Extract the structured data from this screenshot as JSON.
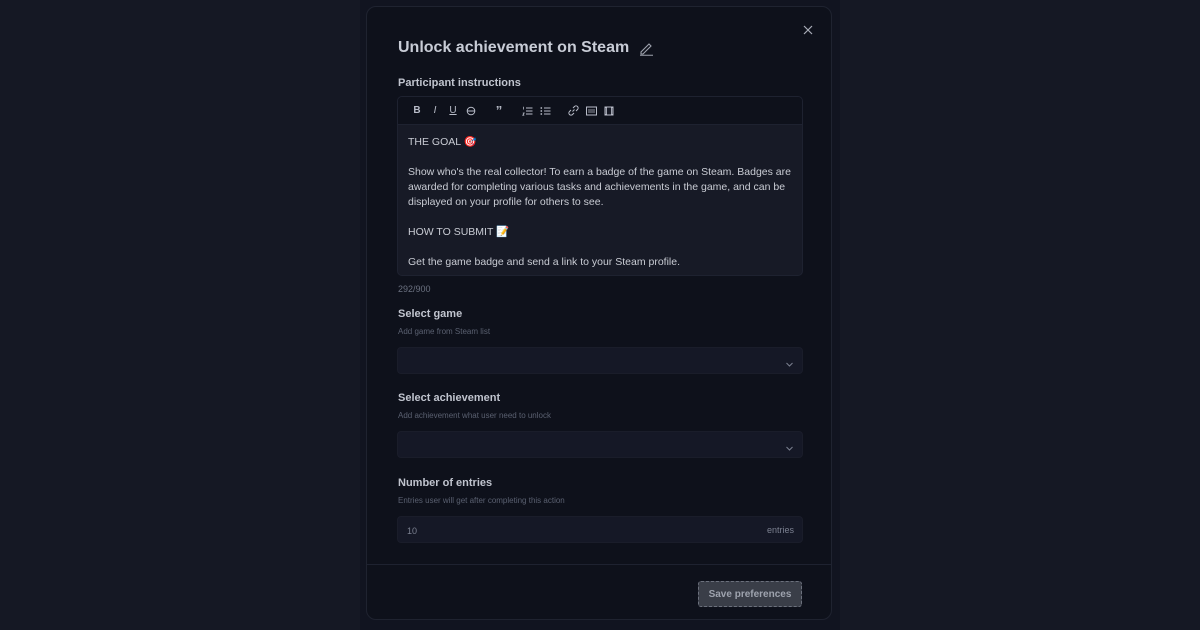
{
  "modal": {
    "title": "Unlock achievement on Steam",
    "instructions": {
      "label": "Participant instructions",
      "toolbar": {
        "bold": "B",
        "italic": "I",
        "underline": "U",
        "quote": "”"
      },
      "content": [
        "THE GOAL 🎯",
        "Show who's the real collector! To earn a badge of the game on Steam. Badges are awarded for completing various tasks and achievements in the game, and can be displayed on your profile for others to see.",
        "HOW TO SUBMIT 📝",
        "Get the game badge and send a link to your Steam profile."
      ],
      "counter": "292/900"
    },
    "game": {
      "label": "Select game",
      "hint": "Add game from Steam list",
      "value": ""
    },
    "achievement": {
      "label": "Select achievement",
      "hint": "Add achievement what user need to unlock",
      "value": ""
    },
    "entries": {
      "label": "Number of entries",
      "hint": "Entries user will get after completing this action",
      "value": "10",
      "suffix": "entries"
    },
    "save_label": "Save preferences"
  },
  "colors": {
    "page_bg": "#151824",
    "modal_bg": "#0e111b",
    "input_bg": "#151826",
    "button_bg": "#3a3e48"
  }
}
